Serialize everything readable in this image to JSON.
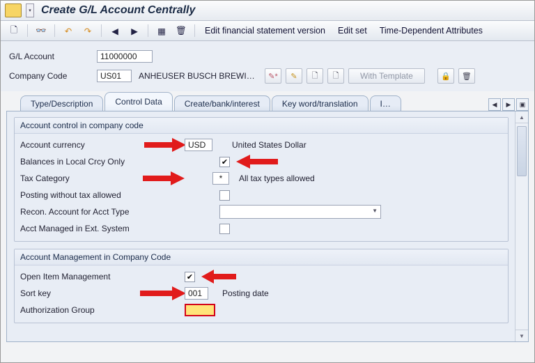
{
  "title": "Create G/L Account Centrally",
  "toolbar": {
    "edit_fsv": "Edit financial statement version",
    "edit_set": "Edit set",
    "time_dep": "Time-Dependent Attributes"
  },
  "header": {
    "gl_label": "G/L Account",
    "gl_value": "11000000",
    "cc_label": "Company Code",
    "cc_value": "US01",
    "cc_desc": "ANHEUSER BUSCH BREWI…",
    "with_template": "With Template"
  },
  "tabs": {
    "t1": "Type/Description",
    "t2": "Control Data",
    "t3": "Create/bank/interest",
    "t4": "Key word/translation",
    "t5": "I…"
  },
  "group1": {
    "title": "Account control in company code",
    "currency_label": "Account currency",
    "currency_value": "USD",
    "currency_desc": "United States Dollar",
    "balances_label": "Balances in Local Crcy Only",
    "taxcat_label": "Tax Category",
    "taxcat_value": "*",
    "taxcat_desc": "All tax types allowed",
    "postnotax_label": "Posting without tax allowed",
    "recon_label": "Recon. Account for Acct Type",
    "ext_label": "Acct Managed in Ext. System"
  },
  "group2": {
    "title": "Account Management in Company Code",
    "openitem_label": "Open Item Management",
    "sortkey_label": "Sort key",
    "sortkey_value": "001",
    "sortkey_desc": "Posting date",
    "authgrp_label": "Authorization Group",
    "authgrp_value": ""
  }
}
